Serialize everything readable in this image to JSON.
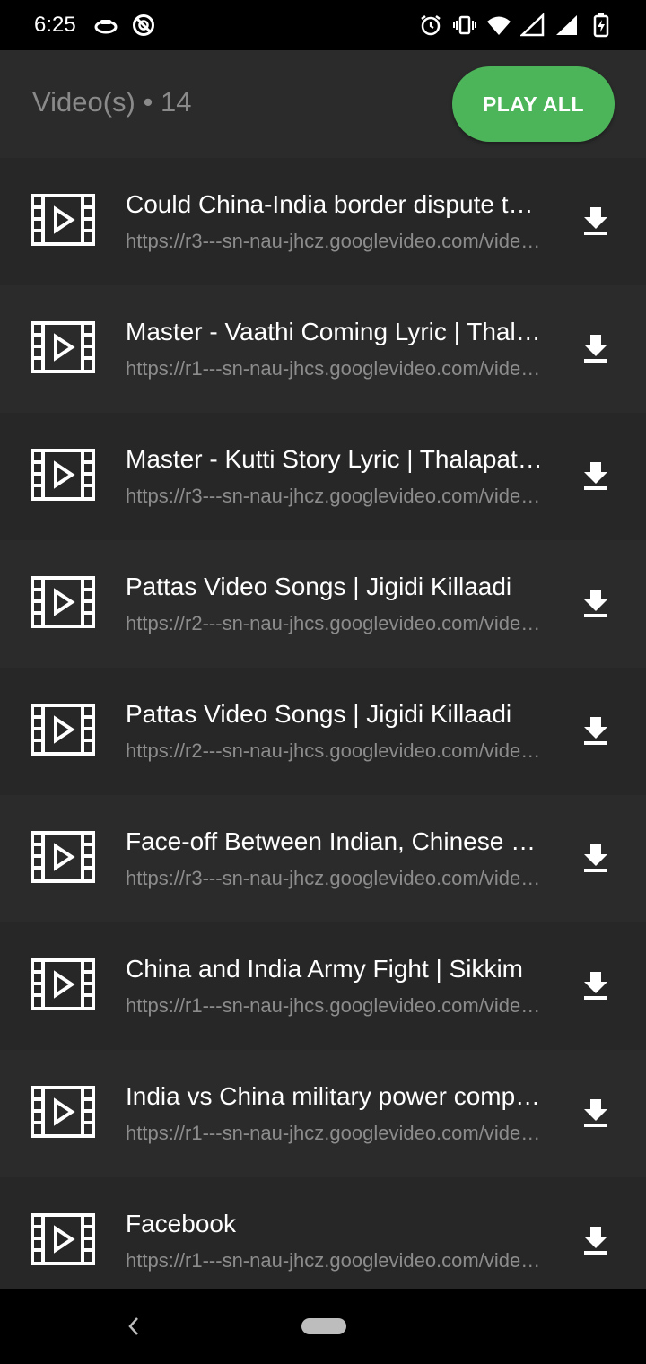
{
  "status_bar": {
    "time": "6:25",
    "left_icons": [
      "android-auto-icon",
      "do-not-disturb-icon"
    ],
    "right_icons": [
      "alarm-icon",
      "vibrate-icon",
      "wifi-icon",
      "signal-icon",
      "signal-icon",
      "battery-charging-icon"
    ]
  },
  "header": {
    "title": "Video(s) • 14",
    "play_all_label": "PLAY ALL",
    "play_all_color": "#4cb55a"
  },
  "videos": [
    {
      "title": "Could China-India border dispute turn into war?",
      "url": "https://r3---sn-nau-jhcz.googlevideo.com/videoplayback"
    },
    {
      "title": "Master - Vaathi Coming Lyric | Thalapathy Vijay",
      "url": "https://r1---sn-nau-jhcs.googlevideo.com/videoplayback"
    },
    {
      "title": "Master - Kutti Story Lyric | Thalapathy Vijay",
      "url": "https://r3---sn-nau-jhcz.googlevideo.com/videoplayback"
    },
    {
      "title": "Pattas Video Songs | Jigidi Killaadi",
      "url": "https://r2---sn-nau-jhcs.googlevideo.com/videoplayback"
    },
    {
      "title": "Pattas Video Songs | Jigidi Killaadi",
      "url": "https://r2---sn-nau-jhcs.googlevideo.com/videoplayback"
    },
    {
      "title": "Face-off Between Indian, Chinese Soldiers",
      "url": "https://r3---sn-nau-jhcz.googlevideo.com/videoplayback"
    },
    {
      "title": "China and India Army Fight | Sikkim",
      "url": "https://r1---sn-nau-jhcs.googlevideo.com/videoplayback"
    },
    {
      "title": "India vs China military power comparison",
      "url": "https://r1---sn-nau-jhcz.googlevideo.com/videoplayback"
    },
    {
      "title": "Facebook",
      "url": "https://r1---sn-nau-jhcz.googlevideo.com/videoplayback"
    }
  ]
}
